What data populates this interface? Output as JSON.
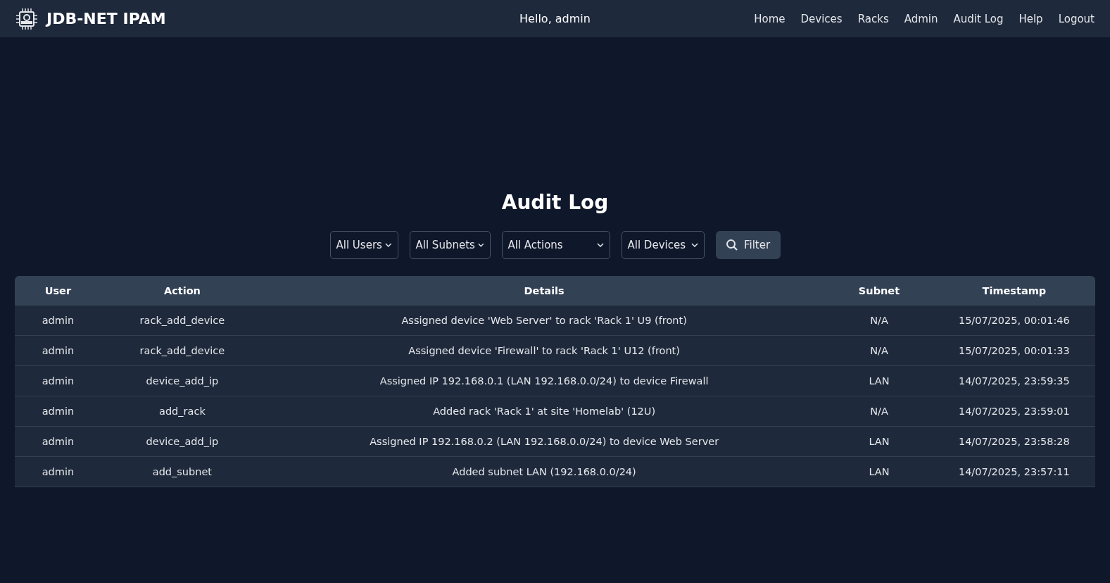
{
  "brand": {
    "title": "JDB-NET IPAM"
  },
  "greeting": "Hello, admin",
  "nav": [
    {
      "label": "Home"
    },
    {
      "label": "Devices"
    },
    {
      "label": "Racks"
    },
    {
      "label": "Admin"
    },
    {
      "label": "Audit Log"
    },
    {
      "label": "Help"
    },
    {
      "label": "Logout"
    }
  ],
  "page_title": "Audit Log",
  "filters": [
    {
      "value": "All Users"
    },
    {
      "value": "All Subnets"
    },
    {
      "value": "All Actions"
    },
    {
      "value": "All Devices"
    }
  ],
  "filter_button": "Filter",
  "table": {
    "columns": [
      "User",
      "Action",
      "Details",
      "Subnet",
      "Timestamp"
    ],
    "rows": [
      [
        "admin",
        "rack_add_device",
        "Assigned device 'Web Server' to rack 'Rack 1' U9 (front)",
        "N/A",
        "15/07/2025, 00:01:46"
      ],
      [
        "admin",
        "rack_add_device",
        "Assigned device 'Firewall' to rack 'Rack 1' U12 (front)",
        "N/A",
        "15/07/2025, 00:01:33"
      ],
      [
        "admin",
        "device_add_ip",
        "Assigned IP 192.168.0.1 (LAN 192.168.0.0/24) to device Firewall",
        "LAN",
        "14/07/2025, 23:59:35"
      ],
      [
        "admin",
        "add_rack",
        "Added rack 'Rack 1' at site 'Homelab' (12U)",
        "N/A",
        "14/07/2025, 23:59:01"
      ],
      [
        "admin",
        "device_add_ip",
        "Assigned IP 192.168.0.2 (LAN 192.168.0.0/24) to device Web Server",
        "LAN",
        "14/07/2025, 23:58:28"
      ],
      [
        "admin",
        "add_subnet",
        "Added subnet LAN (192.168.0.0/24)",
        "LAN",
        "14/07/2025, 23:57:11"
      ]
    ]
  }
}
